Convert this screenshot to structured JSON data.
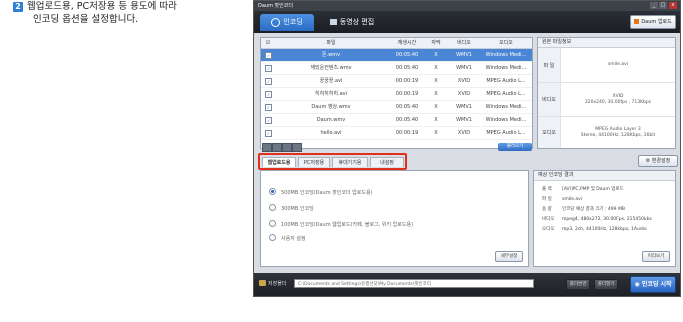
{
  "instruction": {
    "step_number": "2",
    "line1": "웹업로드용, PC저장용 등 용도에 따라",
    "line2": "인코딩 옵션을 설정합니다."
  },
  "window": {
    "title": "Daum 팟인코더",
    "controls": [
      "_",
      "□",
      "x"
    ]
  },
  "main_tabs": [
    {
      "label": "인코딩",
      "active": true
    },
    {
      "label": "동영상 편집",
      "active": false
    }
  ],
  "daum_upload_label": "Daum 업로드",
  "file_list": {
    "headers": [
      "파일",
      "재생시간",
      "자막",
      "비디오",
      "오디오"
    ],
    "rows": [
      {
        "name": "똔.wmv",
        "duration": "00:05:40",
        "sub": "X",
        "video": "WMV1",
        "audio": "Windows Medi...",
        "selected": true
      },
      {
        "name": "재밌운컨텐츠.wmv",
        "duration": "00:05:40",
        "sub": "X",
        "video": "WMV1",
        "audio": "Windows Medi...",
        "selected": false
      },
      {
        "name": "꿍꿍꿍.avi",
        "duration": "00:00:19",
        "sub": "X",
        "video": "XVID",
        "audio": "MPEG Audio L...",
        "selected": false
      },
      {
        "name": "히히히히히.avi",
        "duration": "00:00:19",
        "sub": "X",
        "video": "XVID",
        "audio": "MPEG Audio L...",
        "selected": false
      },
      {
        "name": "Daum 영상.wmv",
        "duration": "00:05:40",
        "sub": "X",
        "video": "WMV1",
        "audio": "Windows Medi...",
        "selected": false
      },
      {
        "name": "Daum.wmv",
        "duration": "00:05:40",
        "sub": "X",
        "video": "WMV1",
        "audio": "Windows Medi...",
        "selected": false
      },
      {
        "name": "hello.avi",
        "duration": "00:00:19",
        "sub": "X",
        "video": "XVID",
        "audio": "MPEG Audio L...",
        "selected": false
      }
    ],
    "add_label": "불러오기"
  },
  "source_info": {
    "title": "원본 파일정보",
    "rows": [
      {
        "label": "파 일",
        "lines": [
          "smile.avi"
        ]
      },
      {
        "label": "비디오",
        "lines": [
          "XVID",
          "320x240, 30.00fps , 713Kbps"
        ]
      },
      {
        "label": "오디오",
        "lines": [
          "MPEG Audio Layer 3",
          "Stereo, 44100Hz, 128Kbps, 16bit"
        ]
      }
    ]
  },
  "env_settings_label": "환경설정",
  "sub_tabs": [
    "웹업로드용",
    "PC저장용",
    "휴대기기용",
    "내설정"
  ],
  "options": [
    {
      "label": "500MB 인코딩(Daum 팟인코더 업로드용)",
      "selected": true
    },
    {
      "label": "300MB 인코딩",
      "selected": false
    },
    {
      "label": "100MB 인코딩(Daum 웹업로드(카페, 블로그, 위키 업로드용)",
      "selected": false
    },
    {
      "label": "사용자 설정",
      "selected": false
    }
  ],
  "detail_settings_label": "세부설정",
  "result": {
    "title": "예상 인코딩 결과",
    "rows": [
      {
        "key": "출 력",
        "value": "[AVI]PC,PMP 및 Daum 업로드"
      },
      {
        "key": "파 일",
        "value": "smile.avi"
      },
      {
        "key": "용 량",
        "value": "인코딩 예상 결과 크기 : 499 MB"
      },
      {
        "key": "비디오",
        "value": "mpeg4, 480x272, 30.00Fps, 215450kbs"
      },
      {
        "key": "오디오",
        "value": "mp3, 2ch, 44100Hz, 128kbps, 1Audio"
      }
    ],
    "preview_label": "미리보기"
  },
  "bottom": {
    "save_folder_label": "저장폴더",
    "path": "C:\\Documents and Settings\\유갤선닷\\My Documents\\팟인코더",
    "change_label": "폴더변경",
    "open_label": "폴더열기",
    "start_label": "인코딩 시작"
  }
}
